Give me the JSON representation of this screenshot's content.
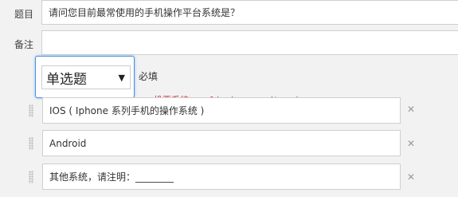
{
  "question": {
    "title_label": "题目",
    "title_value": "请问您目前最常使用的手机操作平台系统是？",
    "note_label": "备注",
    "note_value": ""
  },
  "question_type": {
    "selected": "单选题",
    "required_label": "必填"
  },
  "watermark": "投票系统www.liuchaw.com/toupiao",
  "options": [
    {
      "value": "IOS ( Iphone 系列手机的操作系统 )"
    },
    {
      "value": "Android"
    },
    {
      "value": "其他系统，请注明：________"
    }
  ],
  "icons": {
    "close": "close-icon",
    "drag": "drag-handle-icon",
    "dropdown": "chevron-down-icon"
  },
  "colors": {
    "focus_border": "#4a90e2",
    "watermark": "#e02020"
  }
}
